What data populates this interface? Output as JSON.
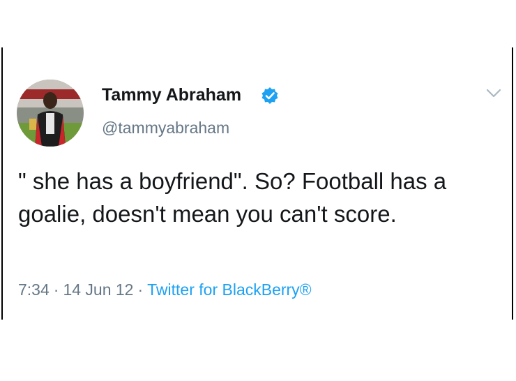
{
  "tweet": {
    "display_name": "Tammy Abraham",
    "handle": "@tammyabraham",
    "verified": true,
    "text": "\" she has a boyfriend\". So? Football has a goalie, doesn't mean you can't score.",
    "time": "7:34",
    "date": "14 Jun 12",
    "separator": "·",
    "source": "Twitter for BlackBerry®"
  },
  "icons": {
    "verified": "verified-badge-icon",
    "menu": "chevron-down-icon"
  },
  "colors": {
    "verified_blue": "#1da1f2",
    "link_blue": "#1da1f2",
    "secondary_text": "#657786",
    "primary_text": "#14171a"
  }
}
